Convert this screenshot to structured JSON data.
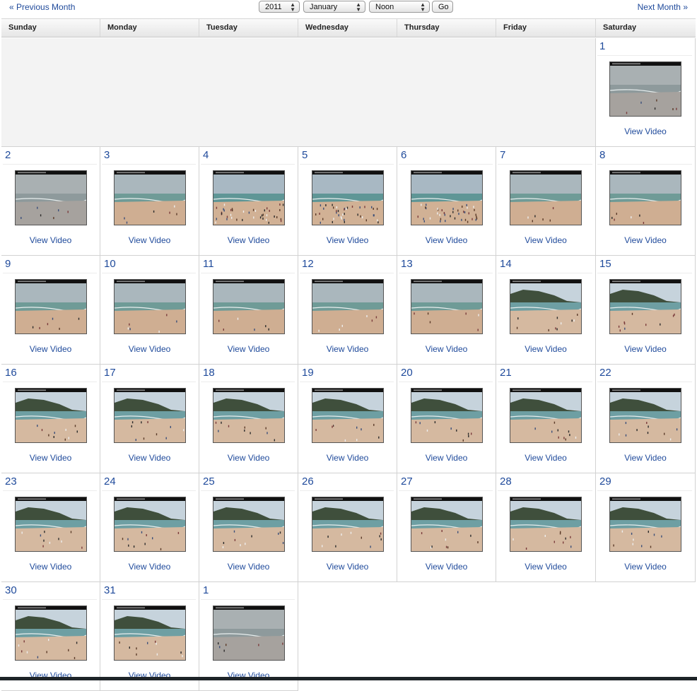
{
  "nav": {
    "prev_label": "« Previous Month",
    "next_label": "Next Month »",
    "year": "2011",
    "month": "January",
    "time": "Noon",
    "go_label": "Go"
  },
  "weekdays": [
    "Sunday",
    "Monday",
    "Tuesday",
    "Wednesday",
    "Thursday",
    "Friday",
    "Saturday"
  ],
  "view_label": "View Video",
  "days": [
    {
      "n": "1",
      "col": 6,
      "row": 0,
      "scene": "gray"
    },
    {
      "n": "2",
      "col": 0,
      "row": 1,
      "scene": "gray"
    },
    {
      "n": "3",
      "col": 1,
      "row": 1,
      "scene": "sand"
    },
    {
      "n": "4",
      "col": 2,
      "row": 1,
      "scene": "crowd"
    },
    {
      "n": "5",
      "col": 3,
      "row": 1,
      "scene": "crowd"
    },
    {
      "n": "6",
      "col": 4,
      "row": 1,
      "scene": "crowd"
    },
    {
      "n": "7",
      "col": 5,
      "row": 1,
      "scene": "sand"
    },
    {
      "n": "8",
      "col": 6,
      "row": 1,
      "scene": "sand"
    },
    {
      "n": "9",
      "col": 0,
      "row": 2,
      "scene": "sand"
    },
    {
      "n": "10",
      "col": 1,
      "row": 2,
      "scene": "sand"
    },
    {
      "n": "11",
      "col": 2,
      "row": 2,
      "scene": "sand"
    },
    {
      "n": "12",
      "col": 3,
      "row": 2,
      "scene": "sand"
    },
    {
      "n": "13",
      "col": 4,
      "row": 2,
      "scene": "sand"
    },
    {
      "n": "14",
      "col": 5,
      "row": 2,
      "scene": "mountain"
    },
    {
      "n": "15",
      "col": 6,
      "row": 2,
      "scene": "mountain"
    },
    {
      "n": "16",
      "col": 0,
      "row": 3,
      "scene": "mountain"
    },
    {
      "n": "17",
      "col": 1,
      "row": 3,
      "scene": "mountain"
    },
    {
      "n": "18",
      "col": 2,
      "row": 3,
      "scene": "mountain"
    },
    {
      "n": "19",
      "col": 3,
      "row": 3,
      "scene": "mountain"
    },
    {
      "n": "20",
      "col": 4,
      "row": 3,
      "scene": "mountain"
    },
    {
      "n": "21",
      "col": 5,
      "row": 3,
      "scene": "mountain"
    },
    {
      "n": "22",
      "col": 6,
      "row": 3,
      "scene": "mountain"
    },
    {
      "n": "23",
      "col": 0,
      "row": 4,
      "scene": "mountain"
    },
    {
      "n": "24",
      "col": 1,
      "row": 4,
      "scene": "mountain"
    },
    {
      "n": "25",
      "col": 2,
      "row": 4,
      "scene": "mountain"
    },
    {
      "n": "26",
      "col": 3,
      "row": 4,
      "scene": "mountain"
    },
    {
      "n": "27",
      "col": 4,
      "row": 4,
      "scene": "mountain"
    },
    {
      "n": "28",
      "col": 5,
      "row": 4,
      "scene": "mountain"
    },
    {
      "n": "29",
      "col": 6,
      "row": 4,
      "scene": "mountain"
    },
    {
      "n": "30",
      "col": 0,
      "row": 5,
      "scene": "mountain"
    },
    {
      "n": "31",
      "col": 1,
      "row": 5,
      "scene": "mountain"
    },
    {
      "n": "1",
      "col": 2,
      "row": 5,
      "scene": "gray"
    }
  ],
  "colors": {
    "link": "#1f4a9b",
    "empty_cell": "#f3f3f3"
  }
}
